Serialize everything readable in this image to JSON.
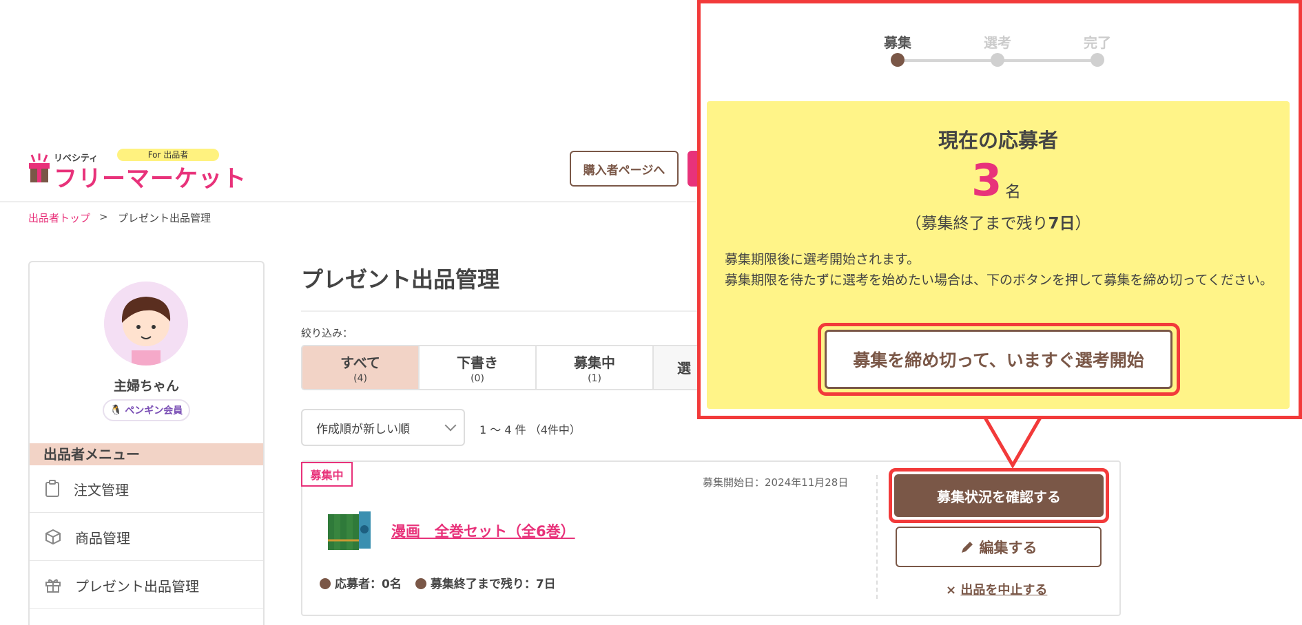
{
  "header": {
    "logo_small": "リベシティ",
    "logo_badge": "For 出品者",
    "logo_main": "フリーマーケット",
    "buyer_button": "購入者ページへ"
  },
  "breadcrumb": {
    "top": "出品者トップ",
    "sep": ">",
    "current": "プレゼント出品管理"
  },
  "sidebar": {
    "user_name": "主婦ちゃん",
    "member": "ペンギン会員",
    "menu_title": "出品者メニュー",
    "items": [
      {
        "label": "注文管理",
        "icon": "clipboard-icon"
      },
      {
        "label": "商品管理",
        "icon": "box-icon"
      },
      {
        "label": "プレゼント出品管理",
        "icon": "gift-icon"
      }
    ]
  },
  "main": {
    "title": "プレゼント出品管理",
    "filter_label": "絞り込み：",
    "tabs": [
      {
        "label": "すべて",
        "count": "(4)"
      },
      {
        "label": "下書き",
        "count": "(0)"
      },
      {
        "label": "募集中",
        "count": "(1)"
      },
      {
        "label": "選",
        "count": ""
      }
    ],
    "sort_value": "作成順が新しい順",
    "count_text": "1 〜 4 件 （4件中）"
  },
  "card": {
    "status": "募集中",
    "start_date": "募集開始日：2024年11月28日",
    "item_title": "漫画　全巻セット（全6巻）",
    "applicants": "応募者：0名",
    "remaining": "募集終了まで残り：7日",
    "check_button": "募集状況を確認する",
    "edit_button": "編集する",
    "cancel_mark": "×",
    "cancel_link": "出品を中止する"
  },
  "callout": {
    "steps": [
      "募集",
      "選考",
      "完了"
    ],
    "current_title": "現在の応募者",
    "count": "3",
    "unit": "名",
    "remain_prefix": "（募集終了まで残り",
    "remain_days": "7日",
    "remain_suffix": "）",
    "notice_line1": "募集期限後に選考開始されます。",
    "notice_line2": "募集期限を待たずに選考を始めたい場合は、下のボタンを押して募集を締め切ってください。",
    "close_button": "募集を締め切って、いますぐ選考開始"
  },
  "colors": {
    "accent_pink": "#e8327a",
    "brown": "#7a5747",
    "highlight_red": "#f23a3a",
    "callout_yellow": "#fff488"
  }
}
